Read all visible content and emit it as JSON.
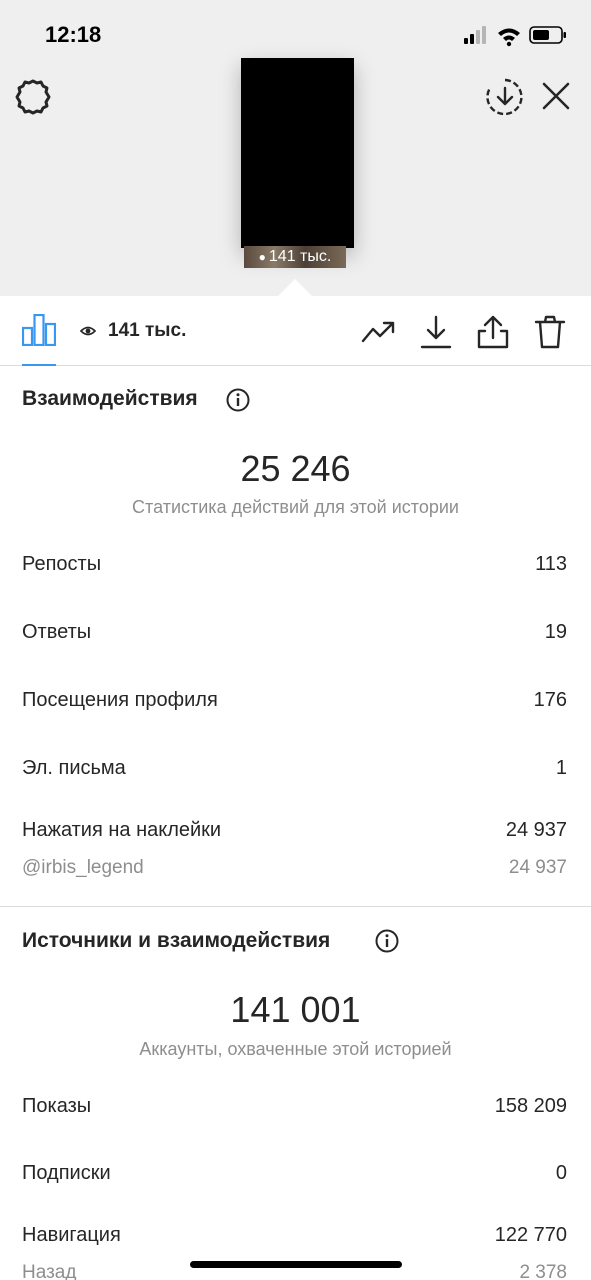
{
  "status": {
    "time": "12:18"
  },
  "story": {
    "thumb_views": "141 тыс."
  },
  "toolbar": {
    "views": "141 тыс."
  },
  "interactions": {
    "title": "Взаимодействия",
    "total": "25 246",
    "subtitle": "Статистика действий для этой истории",
    "rows": [
      {
        "label": "Репосты",
        "value": "113"
      },
      {
        "label": "Ответы",
        "value": "19"
      },
      {
        "label": "Посещения профиля",
        "value": "176"
      },
      {
        "label": "Эл. письма",
        "value": "1"
      },
      {
        "label": "Нажатия на наклейки",
        "value": "24 937"
      },
      {
        "label": "@irbis_legend",
        "value": "24 937"
      }
    ]
  },
  "sources": {
    "title": "Источники и взаимодействия",
    "total": "141 001",
    "subtitle": "Аккаунты, охваченные этой историей",
    "rows": [
      {
        "label": "Показы",
        "value": "158 209"
      },
      {
        "label": "Подписки",
        "value": "0"
      },
      {
        "label": "Навигация",
        "value": "122 770"
      },
      {
        "label": "Назад",
        "value": "2 378"
      }
    ]
  },
  "icons": {
    "settings": "gear-icon",
    "download_circle": "download-circle-icon",
    "close": "close-icon",
    "insights": "bar-chart-icon",
    "views": "eye-icon",
    "promote": "trending-up-icon",
    "download": "download-icon",
    "share": "share-icon",
    "delete": "trash-icon",
    "info": "info-icon"
  },
  "colors": {
    "accent": "#3897f0",
    "text": "#262626",
    "secondary": "#8e8e8e",
    "top_bg": "#efefef"
  }
}
